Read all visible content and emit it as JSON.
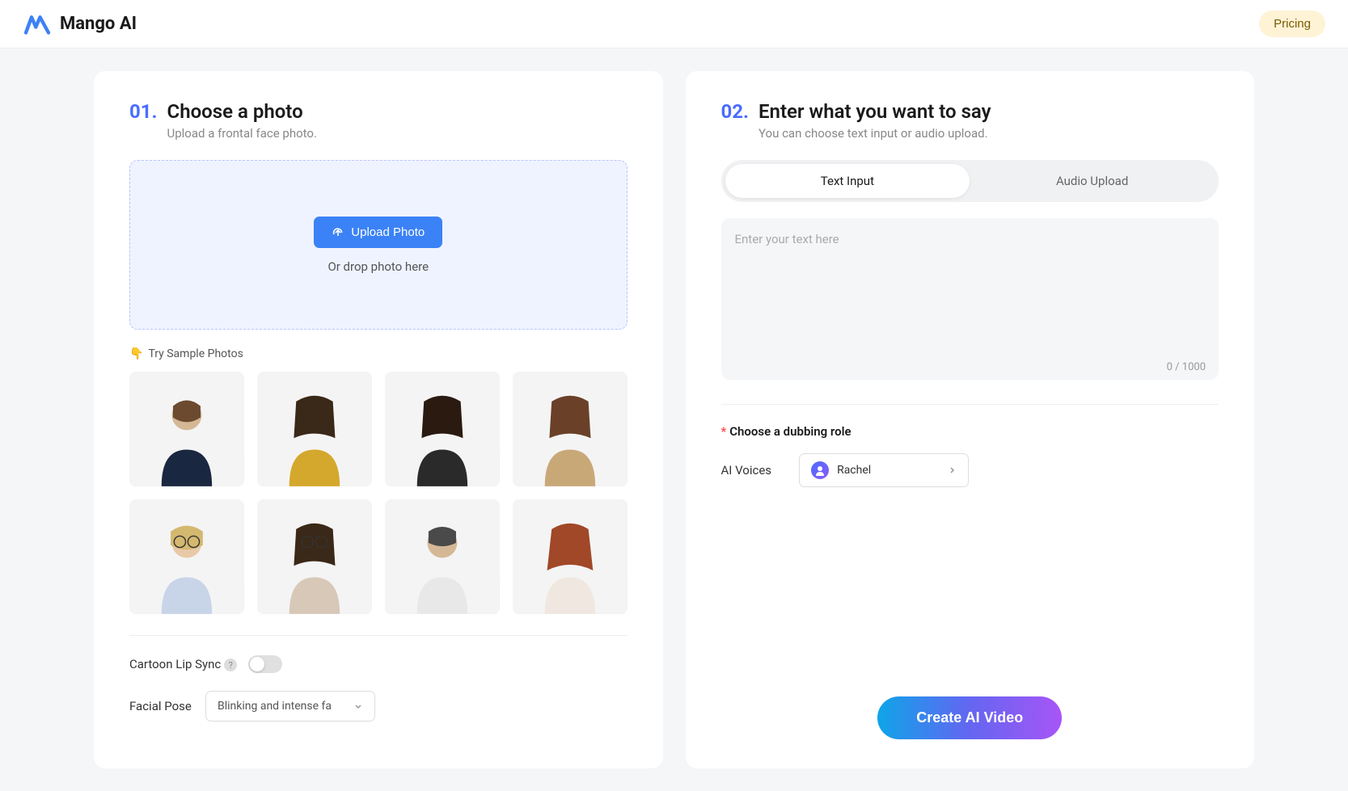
{
  "header": {
    "brand": "Mango AI",
    "pricing": "Pricing"
  },
  "left": {
    "step_num": "01.",
    "title": "Choose a photo",
    "subtitle": "Upload a frontal face photo.",
    "upload_btn": "Upload Photo",
    "drop_text": "Or drop photo here",
    "sample_label": "Try Sample Photos",
    "sample_icon": "👇",
    "cartoon_label": "Cartoon Lip Sync",
    "facial_label": "Facial Pose",
    "facial_value": "Blinking and intense fa"
  },
  "right": {
    "step_num": "02.",
    "title": "Enter what you want to say",
    "subtitle": "You can choose text input or audio upload.",
    "tab_text": "Text Input",
    "tab_audio": "Audio Upload",
    "placeholder": "Enter your text here",
    "char_count": "0 / 1000",
    "dub_label": "Choose a dubbing role",
    "voice_label": "AI Voices",
    "voice_name": "Rachel",
    "create_btn": "Create AI Video"
  }
}
